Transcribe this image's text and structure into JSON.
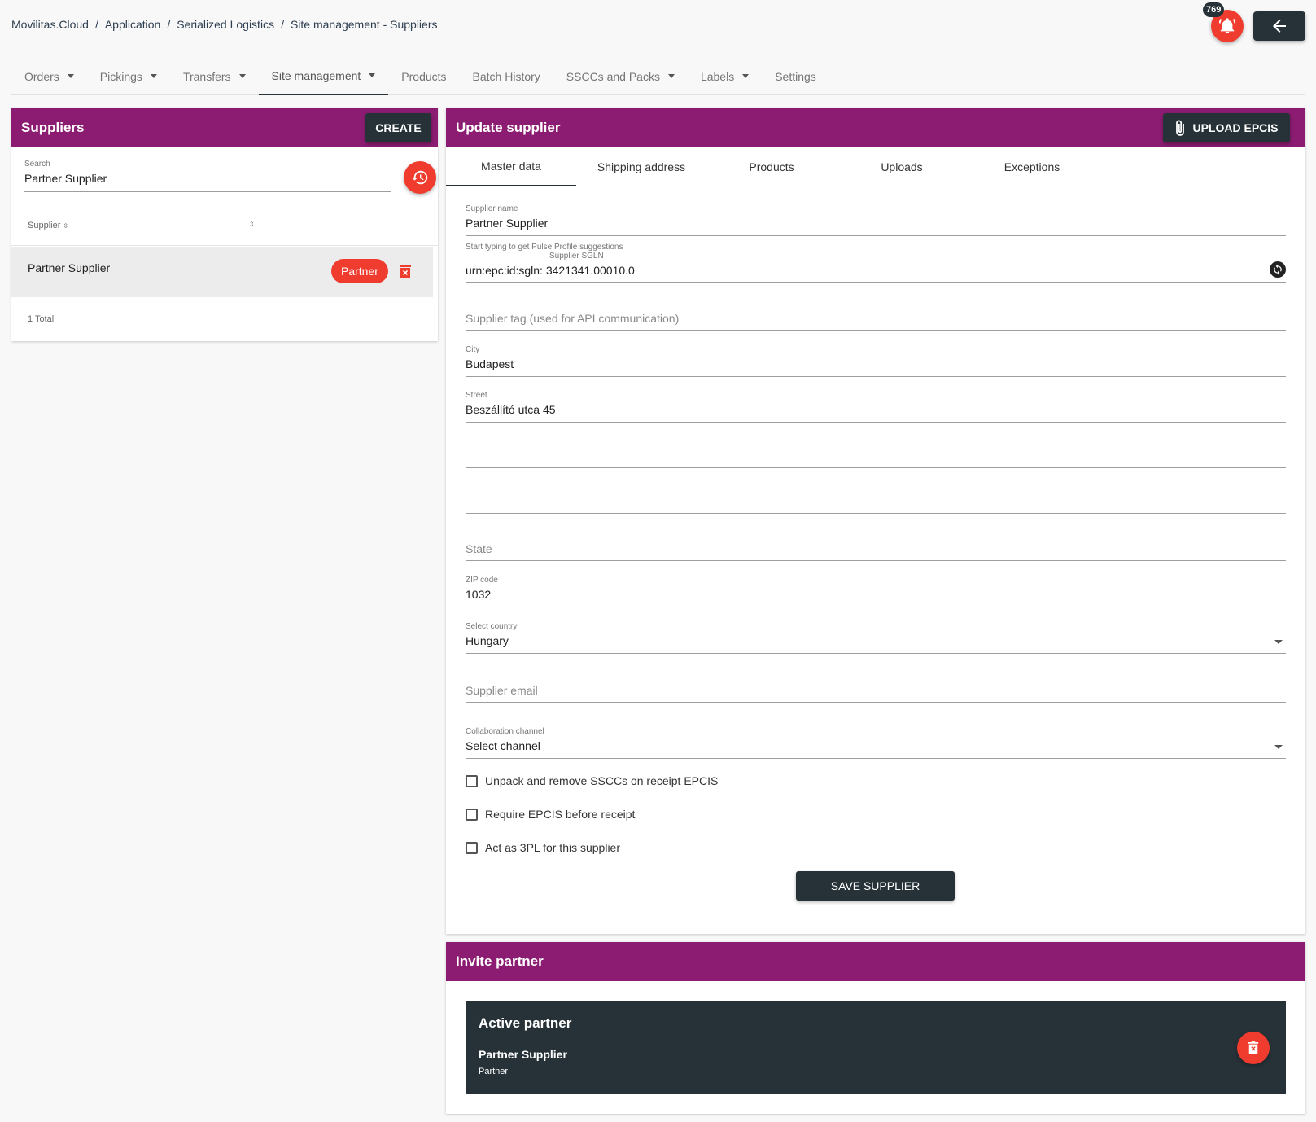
{
  "breadcrumb": [
    "Movilitas.Cloud",
    "Application",
    "Serialized Logistics",
    "Site management - Suppliers"
  ],
  "breadcrumb_sep": "/",
  "notifications": {
    "count": "769"
  },
  "nav": {
    "items": [
      {
        "label": "Orders",
        "dropdown": true
      },
      {
        "label": "Pickings",
        "dropdown": true
      },
      {
        "label": "Transfers",
        "dropdown": true
      },
      {
        "label": "Site management",
        "dropdown": true,
        "active": true
      },
      {
        "label": "Products",
        "dropdown": false
      },
      {
        "label": "Batch History",
        "dropdown": false
      },
      {
        "label": "SSCCs and Packs",
        "dropdown": true
      },
      {
        "label": "Labels",
        "dropdown": true
      },
      {
        "label": "Settings",
        "dropdown": false
      }
    ]
  },
  "suppliers": {
    "title": "Suppliers",
    "create_label": "CREATE",
    "search_label": "Search",
    "search_value": "Partner Supplier",
    "column_header": "Supplier",
    "rows": [
      {
        "name": "Partner Supplier",
        "tag": "Partner"
      }
    ],
    "total": "1 Total"
  },
  "update": {
    "title": "Update supplier",
    "upload_label": "UPLOAD EPCIS",
    "tabs": [
      "Master data",
      "Shipping address",
      "Products",
      "Uploads",
      "Exceptions"
    ],
    "supplier_name_label": "Supplier name",
    "supplier_name": "Partner Supplier",
    "sgln_hint": "Start typing to get Pulse Profile suggestions",
    "sgln_label": "Supplier SGLN",
    "sgln_value": "urn:epc:id:sgln: 3421341.00010.0",
    "tag_placeholder": "Supplier tag (used for API communication)",
    "city_label": "City",
    "city": "Budapest",
    "street_label": "Street",
    "street": "Beszállító utca 45",
    "state_placeholder": "State",
    "zip_label": "ZIP code",
    "zip": "1032",
    "country_label": "Select country",
    "country": "Hungary",
    "email_placeholder": "Supplier email",
    "channel_label": "Collaboration channel",
    "channel": "Select channel",
    "checkboxes": [
      "Unpack and remove SSCCs on receipt EPCIS",
      "Require EPCIS before receipt",
      "Act as 3PL for this supplier"
    ],
    "save_label": "SAVE SUPPLIER"
  },
  "invite": {
    "title": "Invite partner",
    "box_title": "Active partner",
    "partner_name": "Partner Supplier",
    "partner_role": "Partner"
  },
  "colors": {
    "header_purple": "#8b1c71",
    "dark": "#263238",
    "accent_red": "#f03c2e"
  }
}
